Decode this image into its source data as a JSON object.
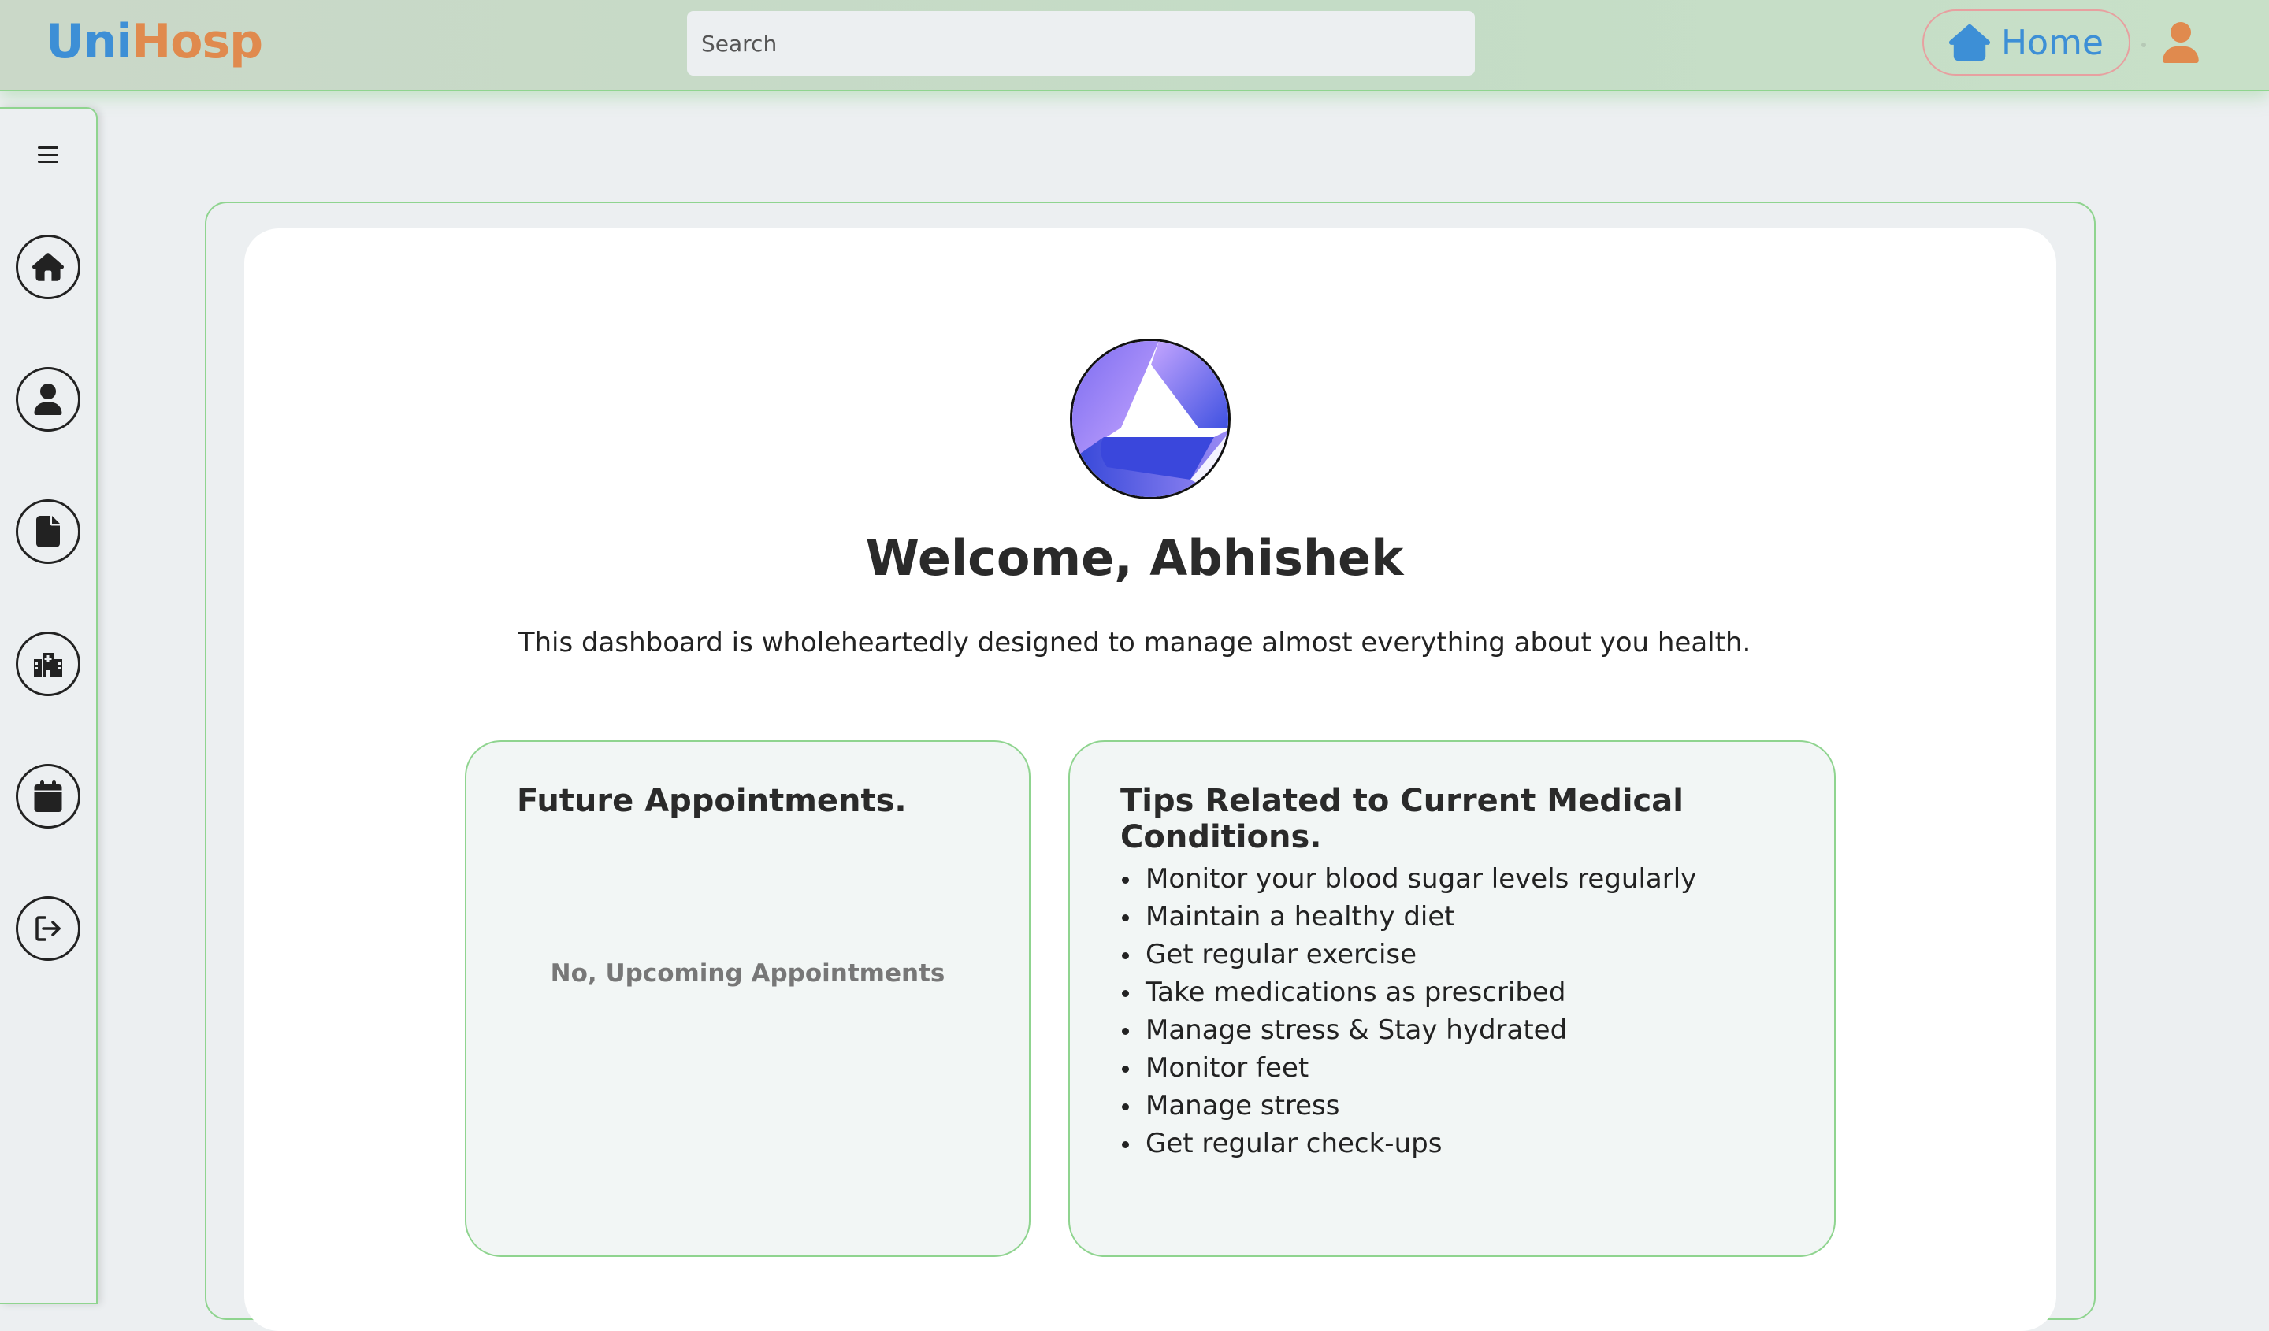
{
  "brand": {
    "part1": "Uni",
    "part2": "Hosp"
  },
  "header": {
    "search_placeholder": "Search",
    "home_label": "Home"
  },
  "sidebar": {
    "items": [
      {
        "name": "home",
        "icon": "home-icon"
      },
      {
        "name": "profile",
        "icon": "user-circle-icon"
      },
      {
        "name": "records",
        "icon": "file-icon"
      },
      {
        "name": "hospitals",
        "icon": "hospital-icon"
      },
      {
        "name": "appointments",
        "icon": "calendar-icon"
      },
      {
        "name": "logout",
        "icon": "logout-icon"
      }
    ]
  },
  "main": {
    "welcome": "Welcome, Abhishek",
    "subtitle": "This dashboard is wholeheartedly designed to manage almost everything about you health.",
    "appointments": {
      "title": "Future Appointments.",
      "empty_message": "No, Upcoming Appointments"
    },
    "tips": {
      "title": "Tips Related to Current Medical Conditions.",
      "items": [
        "Monitor your blood sugar levels regularly",
        "Maintain a healthy diet",
        "Get regular exercise",
        "Take medications as prescribed",
        "Manage stress & Stay hydrated",
        "Monitor feet",
        "Manage stress",
        "Get regular check-ups"
      ]
    }
  },
  "colors": {
    "brand_blue": "#3d8fd6",
    "brand_orange": "#e08a4e",
    "accent_green": "#8fd48f"
  }
}
